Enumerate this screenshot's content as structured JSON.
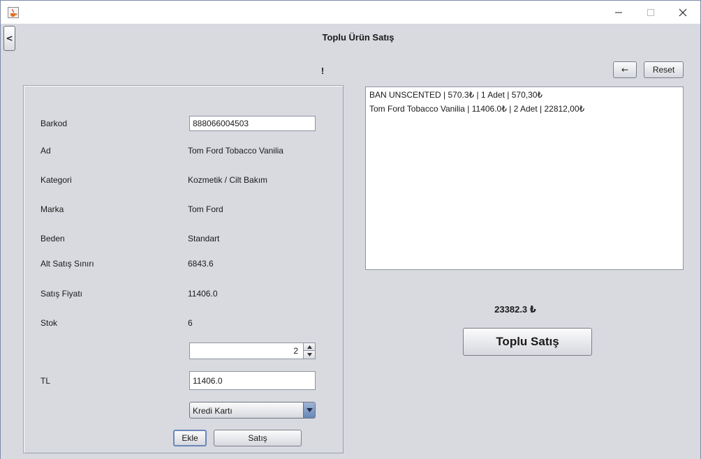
{
  "window": {
    "app_icon": "java-cup-icon",
    "controls": [
      "minimize-icon",
      "maximize-icon",
      "close-icon"
    ]
  },
  "header": {
    "back_label": "<",
    "title": "Toplu Ürün Satış",
    "message": "!"
  },
  "toolbar": {
    "arrow_label": "←",
    "reset_label": "Reset"
  },
  "form": {
    "barkod_label": "Barkod",
    "barkod_value": "888066004503",
    "ad_label": "Ad",
    "ad_value": "Tom Ford Tobacco Vanilia",
    "kategori_label": "Kategori",
    "kategori_value": "Kozmetik / Cilt Bakım",
    "marka_label": "Marka",
    "marka_value": "Tom Ford",
    "beden_label": "Beden",
    "beden_value": "Standart",
    "alt_label": "Alt Satış Sınırı",
    "alt_value": "6843.6",
    "fiyat_label": "Satış Fiyatı",
    "fiyat_value": "11406.0",
    "stok_label": "Stok",
    "stok_value": "6",
    "quantity": "2",
    "tl_label": "TL",
    "tl_value": "11406.0",
    "payment_selected": "Kredi Kartı",
    "ekle_label": "Ekle",
    "satis_label": "Satış"
  },
  "cart": {
    "items": [
      "BAN  UNSCENTED | 570.3₺ | 1 Adet | 570,30₺",
      "Tom Ford Tobacco Vanilia | 11406.0₺ | 2 Adet | 22812,00₺"
    ],
    "total": "23382.3 ₺",
    "submit_label": "Toplu Satış"
  },
  "colors": {
    "background": "#d8dae0",
    "accent": "#6786b8"
  }
}
